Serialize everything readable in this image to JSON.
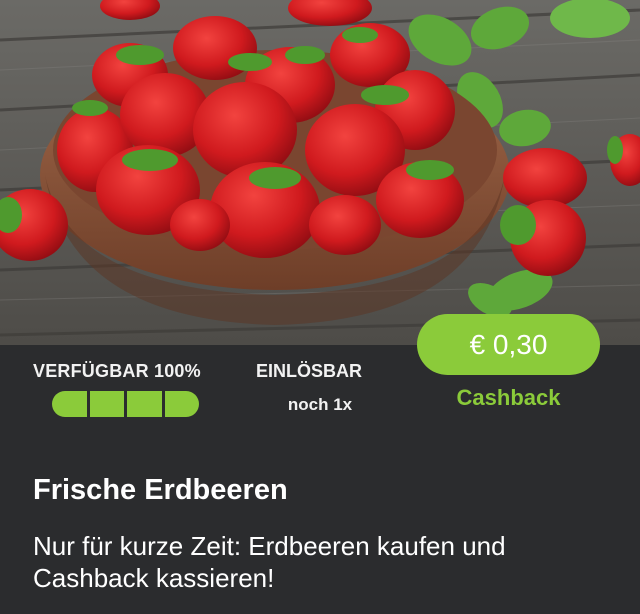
{
  "offer": {
    "availability_label": "VERFÜGBAR 100%",
    "availability_fraction": 1.0,
    "redeemable_label": "EINLÖSBAR",
    "redeemable_count": "noch 1x",
    "cashback_amount": "€ 0,30",
    "cashback_label": "Cashback",
    "title": "Frische Erdbeeren",
    "description": "Nur für kurze Zeit: Erdbeeren kaufen und Cashback kassieren!"
  },
  "colors": {
    "accent": "#8bcb3a",
    "panel_background": "#2b2c2e",
    "text": "#ffffff"
  },
  "image": {
    "subject": "strawberries-in-wooden-bowl"
  }
}
